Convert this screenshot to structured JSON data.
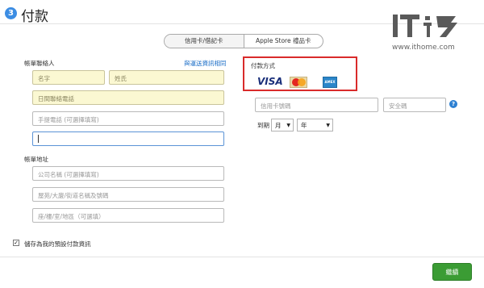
{
  "header": {
    "step": "3",
    "title": "付款"
  },
  "tabs": {
    "credit": "信用卡/借記卡",
    "gift": "Apple Store 禮品卡"
  },
  "billing_contact": {
    "label": "帳單聯絡人",
    "link": "與運送資訊相同",
    "first_name": "名字",
    "last_name": "姓氏",
    "daytime_phone": "日間聯絡電話",
    "mobile": "手提電話 (可選擇填寫)",
    "email_value": ""
  },
  "billing_address": {
    "label": "帳單地址",
    "company": "公司名稱 (可選擇填寫)",
    "street": "屋苑/大廈/街道名稱及號碼",
    "district": "座/樓/室/地區（可選填）"
  },
  "payment": {
    "label": "付款方式",
    "cards": [
      "VISA",
      "MasterCard",
      "AMERICAN EXPRESS"
    ],
    "card_number": "信用卡號碼",
    "security_code": "安全碼",
    "expiry_label": "到期",
    "month": "月",
    "year": "年"
  },
  "save": {
    "checked": true,
    "label": "儲存為我的預設付款資訊"
  },
  "footer": {
    "next": "繼續"
  },
  "watermark": {
    "logo": "IT之家",
    "url": "www.ithome.com"
  }
}
